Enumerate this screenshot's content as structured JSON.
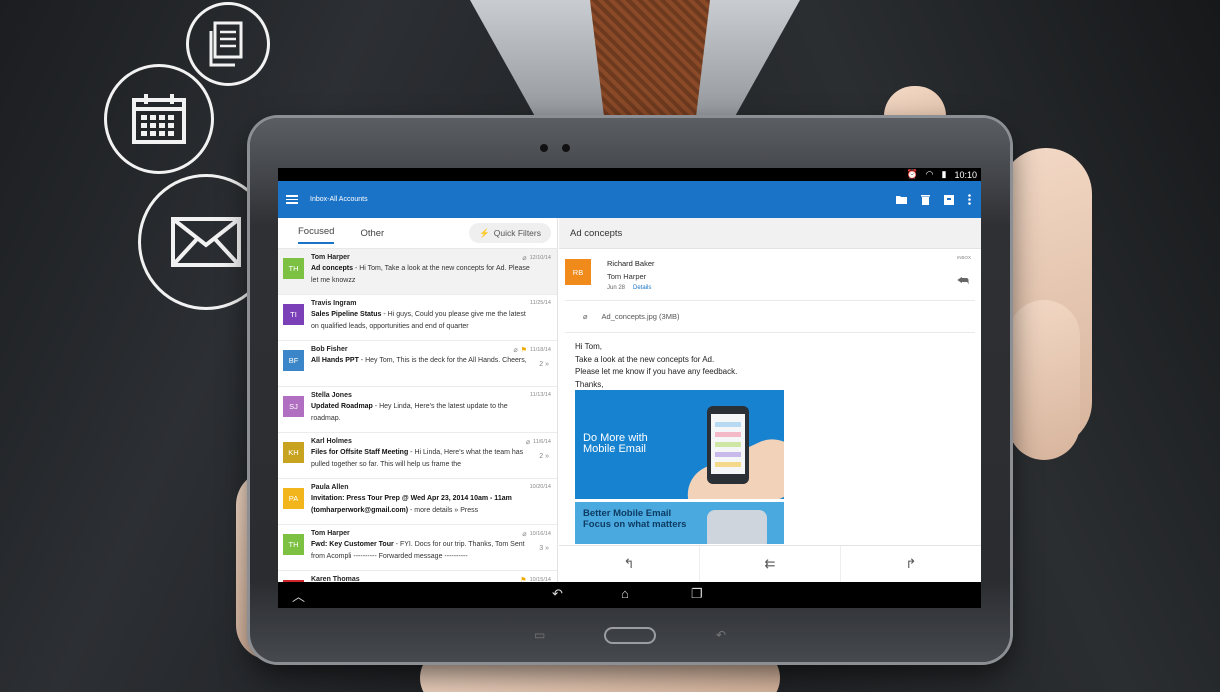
{
  "colors": {
    "appbar": "#1b73c7",
    "accent": "#1b73c7",
    "status_bar": "#000000",
    "flag": "#f0a800"
  },
  "floating_icons": [
    "document-icon",
    "calendar-icon",
    "mail-icon"
  ],
  "status_bar": {
    "time": "10:10"
  },
  "app_bar": {
    "title": "Inbox-All Accounts"
  },
  "tabs": [
    {
      "label": "Focused",
      "selected": true
    },
    {
      "label": "Other",
      "selected": false
    }
  ],
  "quick_filters_label": "Quick Filters",
  "messages": [
    {
      "initials": "TH",
      "avatar_color": "#7cc142",
      "sender": "Tom Harper",
      "subject": "Ad concepts",
      "preview": " - Hi Tom, Take a look at the new concepts for Ad. Please let me knowzz",
      "date": "12/10/14",
      "attachment": true,
      "flag": false,
      "count": "",
      "selected": true
    },
    {
      "initials": "TI",
      "avatar_color": "#7b3fb8",
      "sender": "Travis Ingram",
      "subject": "Sales Pipeline Status",
      "preview": " - Hi guys, Could you please give me the latest on qualified leads, opportunities and end of quarter",
      "date": "11/25/14",
      "attachment": false,
      "flag": false,
      "count": "",
      "selected": false
    },
    {
      "initials": "BF",
      "avatar_color": "#3a86c8",
      "sender": "Bob Fisher",
      "subject": "All Hands PPT",
      "preview": " - Hey Tom, This is the deck for the All Hands. Cheers,",
      "date": "11/18/14",
      "attachment": true,
      "flag": true,
      "count": "2",
      "selected": false
    },
    {
      "initials": "SJ",
      "avatar_color": "#b06fc0",
      "sender": "Stella Jones",
      "subject": "Updated Roadmap",
      "preview": " - Hey Linda, Here's the latest update to the roadmap.",
      "date": "11/13/14",
      "attachment": false,
      "flag": false,
      "count": "",
      "selected": false
    },
    {
      "initials": "KH",
      "avatar_color": "#c8a320",
      "sender": "Karl Holmes",
      "subject": "Files for Offsite Staff Meeting",
      "preview": " - Hi Linda, Here's what the team has pulled together so far. This will help us frame the",
      "date": "11/6/14",
      "attachment": true,
      "flag": false,
      "count": "2",
      "selected": false
    },
    {
      "initials": "PA",
      "avatar_color": "#f2b51c",
      "sender": "Paula Allen",
      "subject": "Invitation: Press Tour Prep @ Wed Apr 23, 2014 10am - 11am (tomharperwork@gmail.com)",
      "preview": " - more details » Press",
      "date": "10/20/14",
      "attachment": false,
      "flag": false,
      "count": "",
      "selected": false
    },
    {
      "initials": "TH",
      "avatar_color": "#7cc142",
      "sender": "Tom Harper",
      "subject": "Fwd: Key Customer Tour",
      "preview": " - FYI. Docs for our trip. Thanks, Tom Sent from Acompli ---------- Forwarded message ----------",
      "date": "10/16/14",
      "attachment": true,
      "flag": false,
      "count": "3",
      "selected": false
    },
    {
      "initials": "",
      "avatar_color": "#d0262b",
      "sender": "Karen Thomas",
      "subject": "",
      "preview": "",
      "date": "10/15/14",
      "attachment": false,
      "flag": true,
      "count": "",
      "selected": false
    }
  ],
  "reading": {
    "subject": "Ad concepts",
    "sender_initials": "RB",
    "from": "Richard Baker",
    "to": "Tom Harper",
    "date": "Jun 28",
    "details_link": "Details",
    "folder": "INBOX",
    "attachment_name": "Ad_concepts.jpg (3MB)",
    "body_lines": [
      "Hi Tom,",
      "Take a look at the new concepts for Ad.",
      "Please let me know if you have any feedback.",
      "Thanks,"
    ],
    "promo_1_text_line1": "Do More with",
    "promo_1_text_line2": "Mobile Email",
    "promo_2_text_line1": "Better Mobile Email",
    "promo_2_text_line2": "Focus on what matters"
  },
  "action_icons": [
    "reply-icon",
    "reply-all-icon",
    "forward-icon"
  ],
  "nav_icons": [
    "up-icon",
    "back-icon",
    "home-icon",
    "recents-icon"
  ]
}
